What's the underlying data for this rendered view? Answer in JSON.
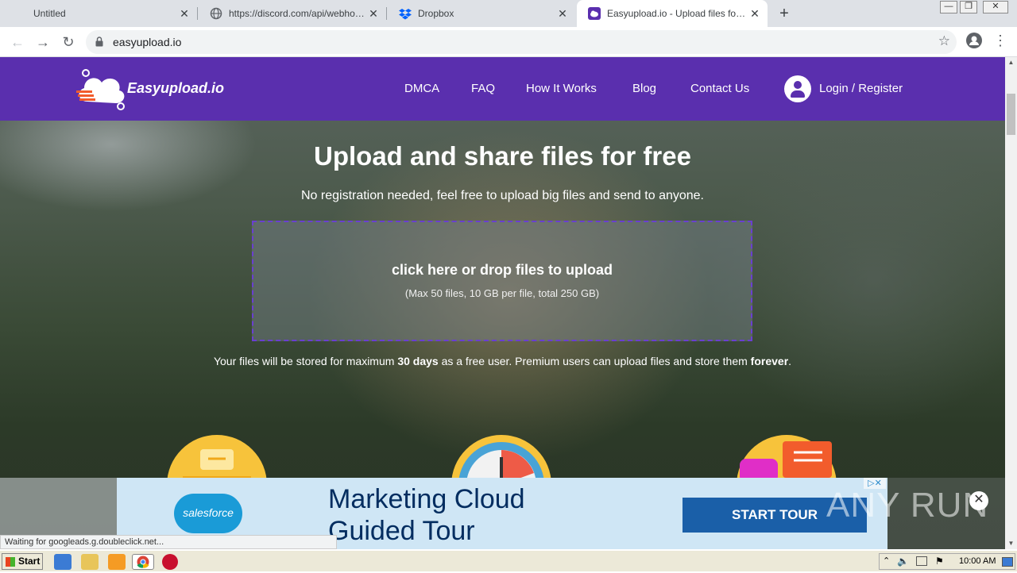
{
  "browser": {
    "tabs": [
      {
        "title": "Untitled",
        "active": false
      },
      {
        "title": "https://discord.com/api/webhooks/9",
        "active": false
      },
      {
        "title": "Dropbox",
        "active": false
      },
      {
        "title": "Easyupload.io - Upload files for free",
        "active": true
      }
    ],
    "url": "easyupload.io",
    "status_text": "Waiting for googleads.g.doubleclick.net..."
  },
  "site": {
    "logo_text": "Easyupload.io",
    "nav": [
      "DMCA",
      "FAQ",
      "How It Works",
      "Blog",
      "Contact Us"
    ],
    "login_label": "Login / Register",
    "hero_title": "Upload and share files for free",
    "hero_subtitle": "No registration needed, feel free to upload big files and send to anyone.",
    "dropzone_main": "click here or drop files to upload",
    "dropzone_sub": "(Max 50 files, 10 GB per file, total 250 GB)",
    "storage_note": {
      "pre": "Your files will be stored for maximum ",
      "days": "30 days",
      "mid": " as a free user. Premium users can upload files and store them ",
      "forever": "forever",
      "end": "."
    }
  },
  "ad": {
    "brand": "salesforce",
    "headline_1": "Marketing Cloud",
    "headline_2": "Guided Tour",
    "cta": "START TOUR"
  },
  "watermark": "ANY RUN",
  "taskbar": {
    "start_label": "Start",
    "clock": "10:00 AM"
  },
  "colors": {
    "site_purple": "#5a2fae",
    "ad_bg": "#cfe6f5",
    "cta_blue": "#1a5fa8"
  }
}
